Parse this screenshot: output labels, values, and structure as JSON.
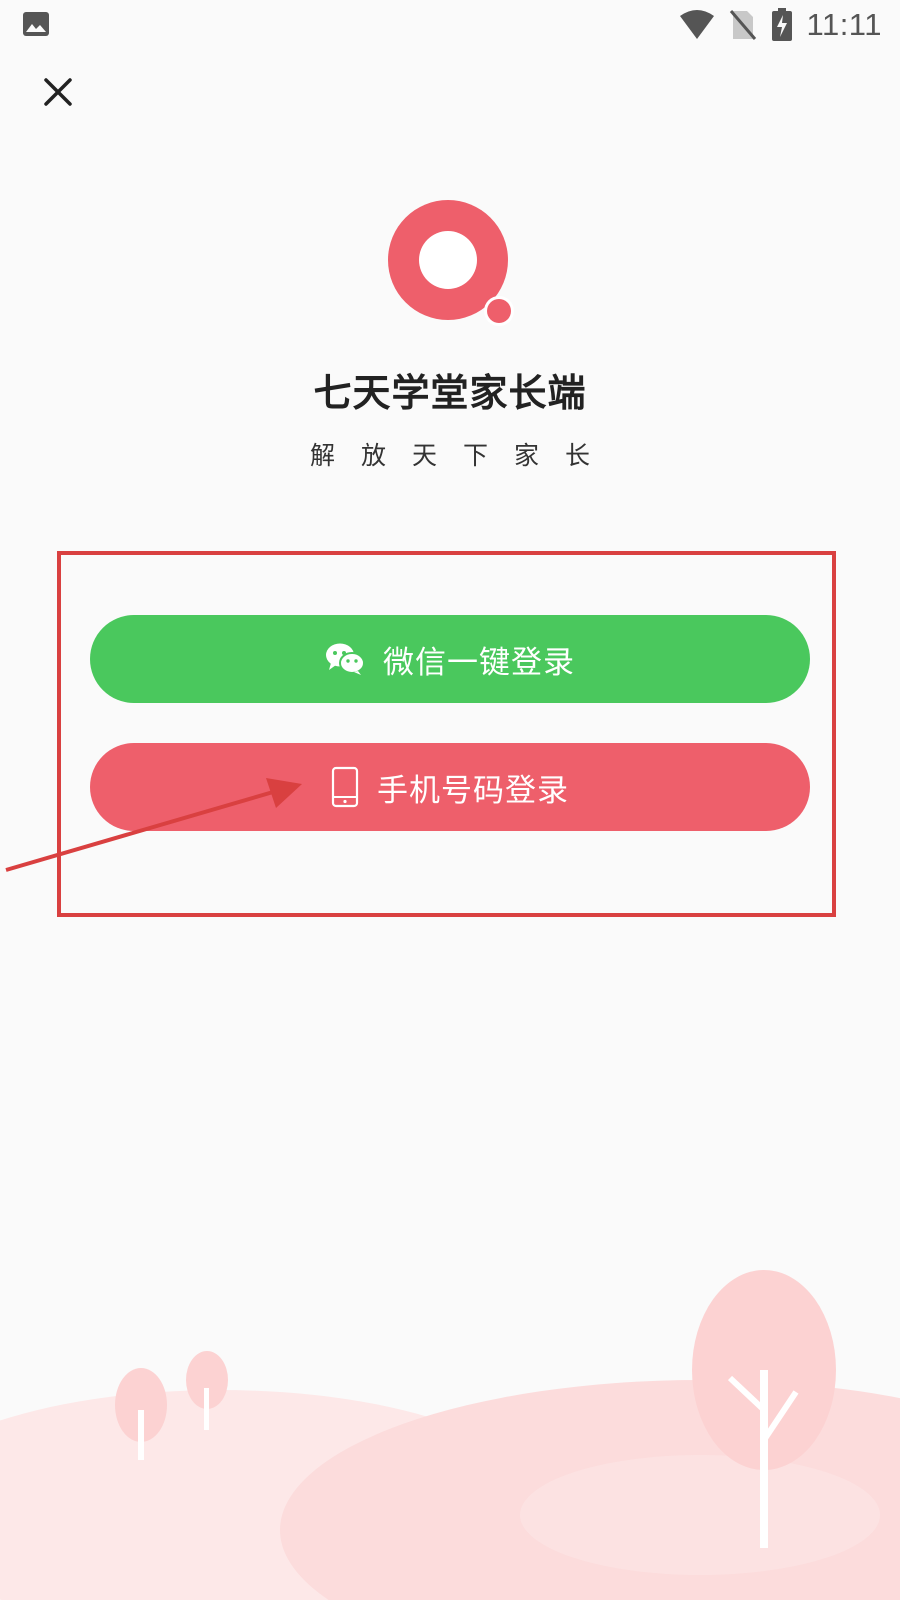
{
  "status_bar": {
    "time": "11:11",
    "left_icon": "gallery-icon",
    "right_icons": [
      "wifi-icon",
      "no-sim-icon",
      "battery-charging-icon"
    ]
  },
  "header": {
    "close_icon": "close-icon"
  },
  "brand": {
    "logo_icon": "app-logo-icon",
    "app_name": "七天学堂家长端",
    "tagline": "解放天下家长",
    "accent_color": "#ee5f6b"
  },
  "login": {
    "wechat_button": {
      "label": "微信一键登录",
      "icon": "wechat-icon",
      "color": "#4ac85d"
    },
    "phone_button": {
      "label": "手机号码登录",
      "icon": "mobile-phone-icon",
      "color": "#ee5f6b"
    }
  },
  "annotation": {
    "color": "#d94040"
  }
}
